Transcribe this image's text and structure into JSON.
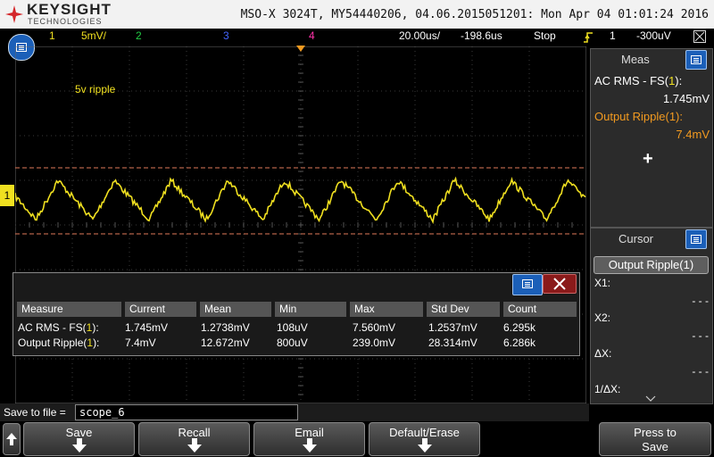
{
  "header": {
    "brand": "KEYSIGHT",
    "brand_sub": "TECHNOLOGIES",
    "title": "MSO-X 3024T, MY54440206, 04.06.2015051201: Mon Apr 04 01:01:24 2016"
  },
  "channel_bar": {
    "ch1_num": "1",
    "ch1_scale": "5mV/",
    "ch2_num": "2",
    "ch3_num": "3",
    "ch4_num": "4",
    "timebase": "20.00us/",
    "delay": "-198.6us",
    "run_state": "Stop",
    "trigger_source": "1",
    "trigger_level": "-300uV",
    "ch1_color": "#f0e020",
    "ch2_color": "#22cc44",
    "ch3_color": "#4466ff",
    "ch4_color": "#ff33aa"
  },
  "waveform": {
    "label": "5v ripple",
    "channel_marker": "1"
  },
  "meas_panel": {
    "title": "Meas",
    "item1_label_prefix": "AC RMS - FS(",
    "item1_label_ch": "1",
    "item1_label_suffix": "):",
    "item1_value": "1.745mV",
    "item2_label": "Output Ripple(1):",
    "item2_value": "7.4mV",
    "add_symbol": "+"
  },
  "cursor_panel": {
    "title": "Cursor",
    "selected": "Output Ripple(1)",
    "x1_label": "X1:",
    "x1_value": "- - -",
    "x2_label": "X2:",
    "x2_value": "- - -",
    "dx_label": "ΔX:",
    "dx_value": "- - -",
    "inv_dx_label": "1/ΔX:"
  },
  "measure_table": {
    "headers": [
      "Measure",
      "Current",
      "Mean",
      "Min",
      "Max",
      "Std Dev",
      "Count"
    ],
    "rows": [
      {
        "measure_prefix": "AC RMS - FS(",
        "measure_ch": "1",
        "measure_suffix": "):",
        "current": "1.745mV",
        "mean": "1.2738mV",
        "min": "108uV",
        "max": "7.560mV",
        "std_dev": "1.2537mV",
        "count": "6.295k"
      },
      {
        "measure_prefix": "Output Ripple(",
        "measure_ch": "1",
        "measure_suffix": "):",
        "current": "7.4mV",
        "mean": "12.672mV",
        "min": "800uV",
        "max": "239.0mV",
        "std_dev": "28.314mV",
        "count": "6.286k"
      }
    ]
  },
  "save": {
    "label": "Save to file =",
    "filename": "scope_6"
  },
  "softkeys": {
    "save": "Save",
    "recall": "Recall",
    "email": "Email",
    "default_erase": "Default/Erase",
    "press_to": "Press to",
    "press_save": "Save"
  }
}
